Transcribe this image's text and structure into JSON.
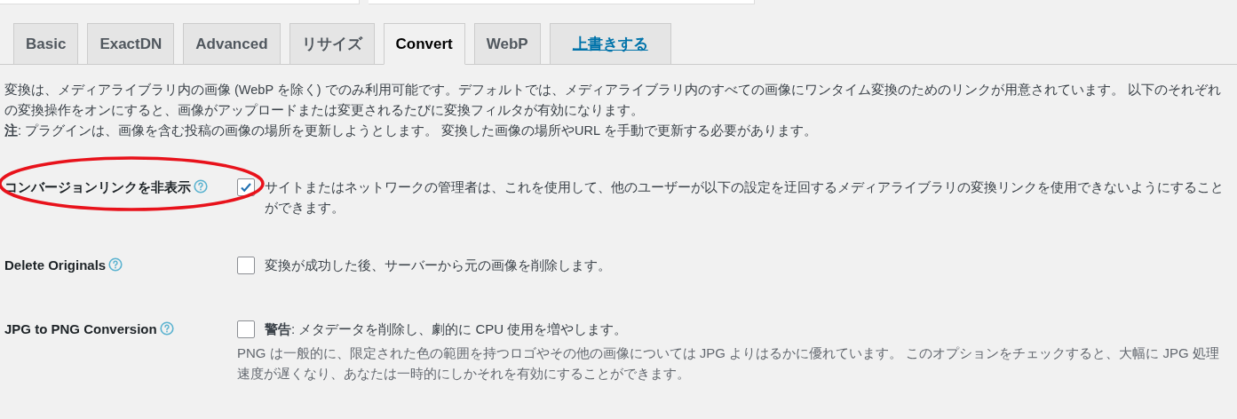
{
  "tabs": [
    {
      "label": "Basic",
      "kind": "tab",
      "selected": false
    },
    {
      "label": "ExactDN",
      "kind": "tab",
      "selected": false
    },
    {
      "label": "Advanced",
      "kind": "tab",
      "selected": false
    },
    {
      "label": "リサイズ",
      "kind": "tab",
      "selected": false
    },
    {
      "label": "Convert",
      "kind": "tab",
      "selected": true
    },
    {
      "label": "WebP",
      "kind": "tab",
      "selected": false
    },
    {
      "label": "上書きする",
      "kind": "link",
      "selected": false
    }
  ],
  "intro": [
    "変換は、メディアライブラリ内の画像 (WebP を除く) でのみ利用可能です。デフォルトでは、メディアライブラリ内のすべての画像にワンタイム変換のためのリンクが用意されています。 以下のそれぞれの変換操作をオンにすると、画像がアップロードまたは変更されるたびに変換フィルタが有効になります。",
    "**注**: プラグインは、画像を含む投稿の画像の場所を更新しようとします。 変換した画像の場所やURL を手動で更新する必要があります。"
  ],
  "settings": [
    {
      "label": "コンバージョンリンクを非表示",
      "highlighted": true,
      "checked": true,
      "description": "サイトまたはネットワークの管理者は、これを使用して、他のユーザーが以下の設定を迂回するメディアライブラリの変換リンクを使用できないようにすることができます。"
    },
    {
      "label": "Delete Originals",
      "highlighted": false,
      "checked": false,
      "description": "変換が成功した後、サーバーから元の画像を削除します。"
    },
    {
      "label": "JPG to PNG Conversion",
      "highlighted": false,
      "checked": false,
      "description": "**警告**: メタデータを削除し、劇的に CPU 使用を増やします。",
      "notes": [
        "PNG は一般的に、限定された色の範囲を持つロゴやその他の画像については JPG よりはるかに優れています。 このオプションをチェックすると、大幅に JPG 処理速度が遅くなり、あなたは一時的にしかそれを有効にすることができます。"
      ]
    }
  ]
}
